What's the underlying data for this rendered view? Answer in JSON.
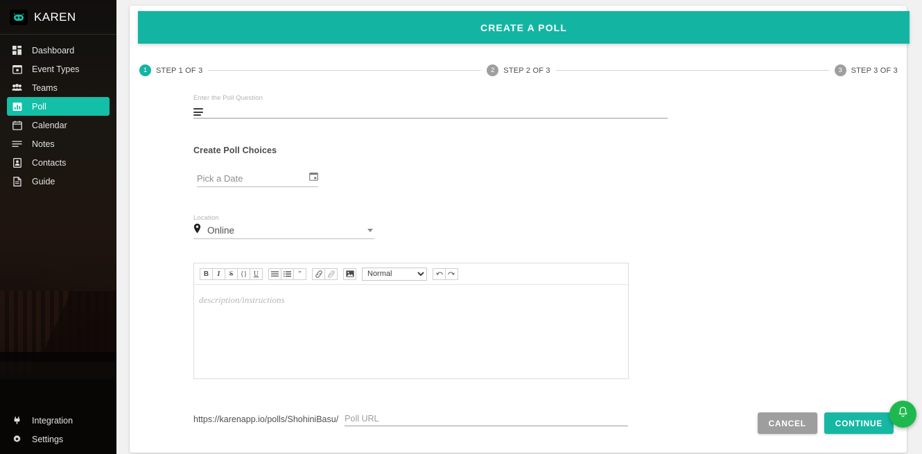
{
  "brand": {
    "name": "KAREN",
    "logo_icon": "robot-logo-icon"
  },
  "sidebar": {
    "items": [
      {
        "label": "Dashboard",
        "icon": "dashboard-icon",
        "active": false
      },
      {
        "label": "Event Types",
        "icon": "calendar-event-icon",
        "active": false
      },
      {
        "label": "Teams",
        "icon": "people-icon",
        "active": false
      },
      {
        "label": "Poll",
        "icon": "poll-bars-icon",
        "active": true
      },
      {
        "label": "Calendar",
        "icon": "calendar-icon",
        "active": false
      },
      {
        "label": "Notes",
        "icon": "notes-lines-icon",
        "active": false
      },
      {
        "label": "Contacts",
        "icon": "contact-card-icon",
        "active": false
      },
      {
        "label": "Guide",
        "icon": "document-icon",
        "active": false
      }
    ],
    "bottom_items": [
      {
        "label": "Integration",
        "icon": "plug-icon"
      },
      {
        "label": "Settings",
        "icon": "gear-icon"
      }
    ],
    "active_color": "#13bfa6"
  },
  "header": {
    "title": "CREATE A POLL",
    "bg_color": "#13b5a2"
  },
  "stepper": {
    "steps": [
      {
        "number": "1",
        "label": "STEP 1 OF 3",
        "active": true
      },
      {
        "number": "2",
        "label": "STEP 2 OF 3",
        "active": false
      },
      {
        "number": "3",
        "label": "STEP 3 OF 3",
        "active": false
      }
    ],
    "active_color": "#13b5a2",
    "inactive_color": "#9e9e9e"
  },
  "form": {
    "question": {
      "label": "Enter the Poll Question",
      "value": "",
      "icon": "list-lines-icon"
    },
    "choices_title": "Create Poll Choices",
    "date": {
      "placeholder": "Pick a Date",
      "value": "",
      "icon": "calendar-picker-icon"
    },
    "location": {
      "label": "Location",
      "value": "Online",
      "icon": "map-pin-icon",
      "caret": "chevron-down-icon",
      "options": [
        "Online"
      ]
    },
    "editor": {
      "placeholder": "description/instructions",
      "value": "",
      "toolbar": {
        "bold": "B",
        "italic": "I",
        "strikethrough": "S",
        "code": "{}",
        "underline": "U",
        "ordered_list": "ordered-list-icon",
        "bullet_list": "bullet-list-icon",
        "blockquote": "”",
        "link": "link-icon",
        "unlink": "unlink-icon",
        "image": "image-icon",
        "format_value": "Normal",
        "format_options": [
          "Normal"
        ],
        "undo": "undo-icon",
        "redo": "redo-icon"
      }
    },
    "url": {
      "prefix": "https://karenapp.io/polls/ShohiniBasu/",
      "placeholder": "Poll URL",
      "value": ""
    }
  },
  "actions": {
    "cancel_label": "CANCEL",
    "continue_label": "CONTINUE",
    "cancel_color": "#9e9e9e",
    "continue_color": "#16b8a4"
  },
  "fab": {
    "icon": "bell-icon",
    "color": "#1eb94e"
  }
}
